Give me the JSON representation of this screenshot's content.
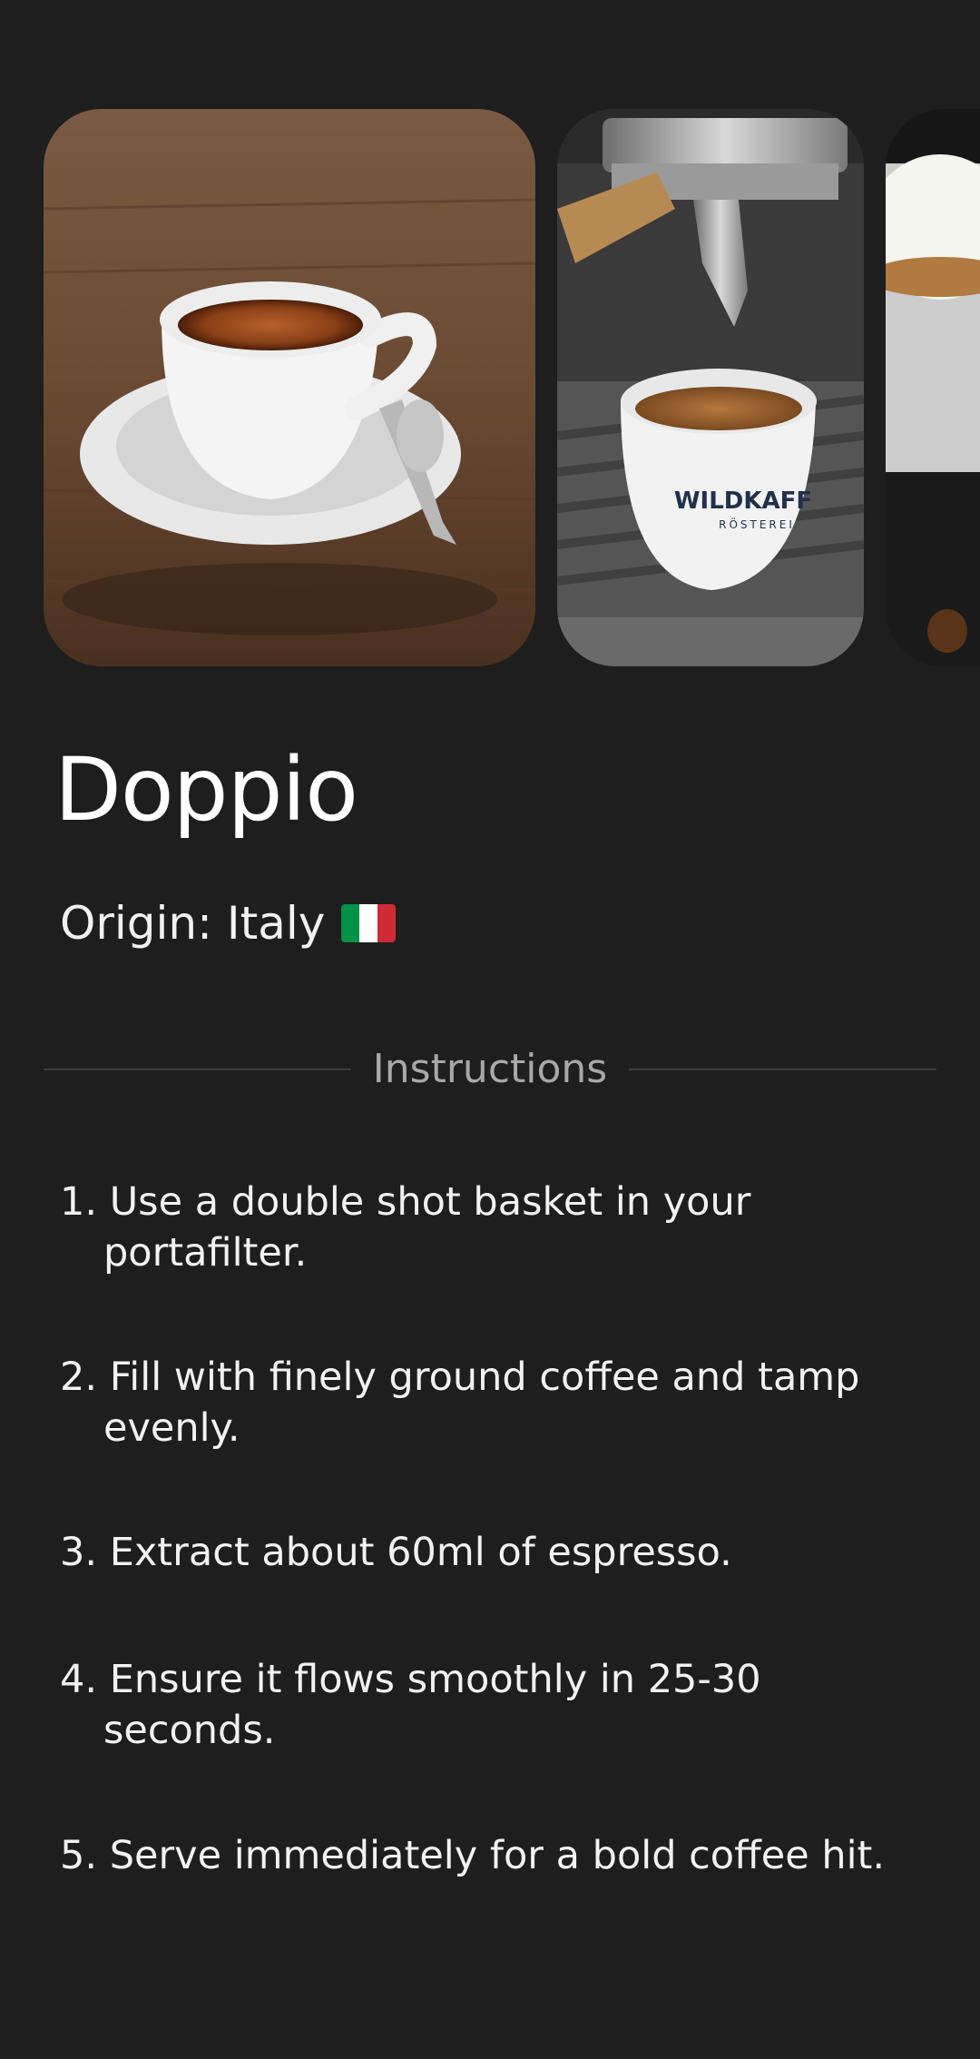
{
  "carousel": {
    "images": [
      {
        "alt": "espresso-cup-on-saucer"
      },
      {
        "alt": "espresso-machine-extraction"
      },
      {
        "alt": "milk-foam-mug"
      }
    ],
    "cup_brand": "WILDKAFF",
    "cup_sub": "RÖSTEREI"
  },
  "drink": {
    "name": "Doppio",
    "origin_label": "Origin: Italy",
    "origin_flag_colors": [
      "#009246",
      "#ffffff",
      "#ce2b37"
    ]
  },
  "section": {
    "label": "Instructions"
  },
  "steps": [
    {
      "line1": "1. Use a double shot basket in your",
      "line2": "portafilter."
    },
    {
      "line1": "2. Fill with finely ground coffee and tamp",
      "line2": "evenly."
    },
    {
      "line1": "3. Extract about 60ml of espresso.",
      "line2": ""
    },
    {
      "line1": "4. Ensure it flows smoothly in 25-30",
      "line2": "seconds."
    },
    {
      "line1": "5. Serve immediately for a bold coffee hit.",
      "line2": ""
    }
  ],
  "colors": {
    "background": "#1e1e1e",
    "text": "#f2f2f2",
    "muted": "#a8a8a8",
    "divider": "#3c3c3c"
  }
}
